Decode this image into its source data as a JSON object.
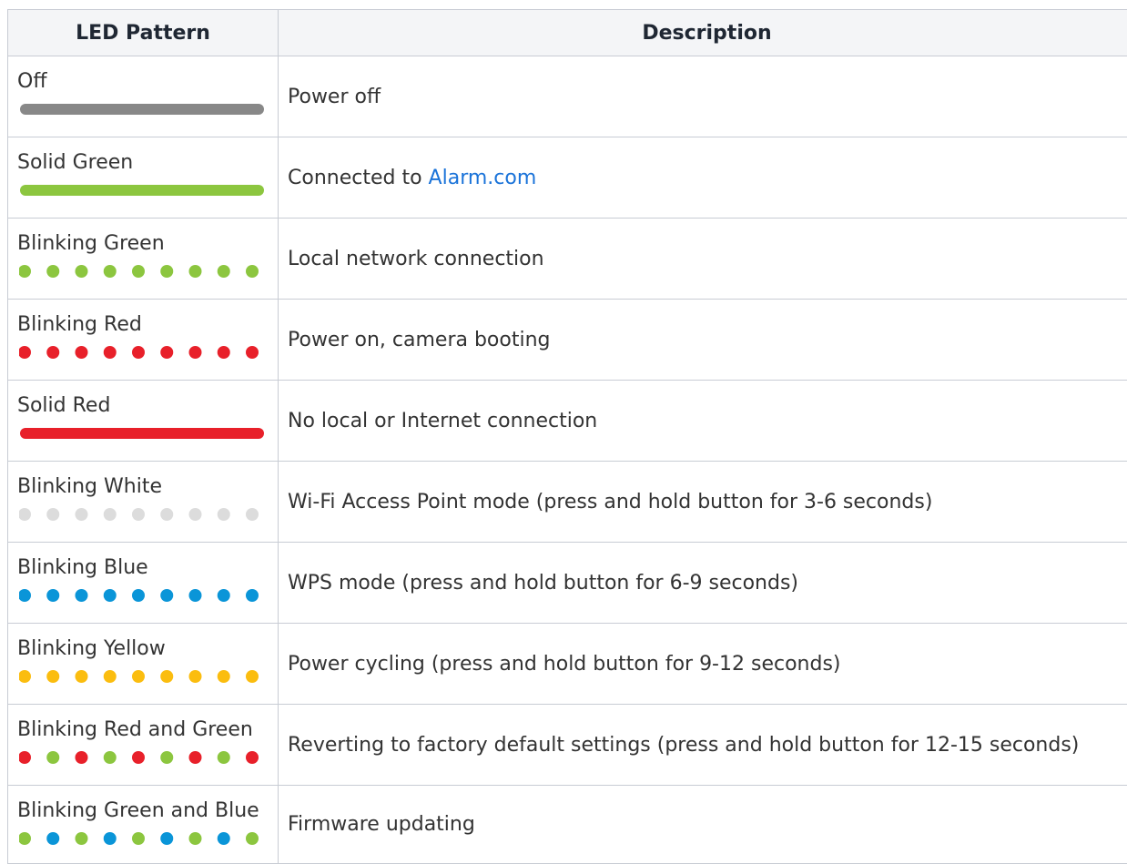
{
  "table": {
    "headers": {
      "pattern": "LED Pattern",
      "description": "Description"
    },
    "rows": [
      {
        "name": "Off",
        "style": "solid",
        "colors": [
          "#888888"
        ],
        "description": "Power off",
        "link": ""
      },
      {
        "name": "Solid Green",
        "style": "solid",
        "colors": [
          "#8cc63f"
        ],
        "description": "Connected to ",
        "link": "Alarm.com"
      },
      {
        "name": "Blinking Green",
        "style": "dots",
        "colors": [
          "#8cc63f"
        ],
        "description": "Local network connection",
        "link": ""
      },
      {
        "name": "Blinking Red",
        "style": "dots",
        "colors": [
          "#e8202a"
        ],
        "description": "Power on, camera booting",
        "link": ""
      },
      {
        "name": "Solid Red",
        "style": "solid",
        "colors": [
          "#e8202a"
        ],
        "description": "No local or Internet connection",
        "link": ""
      },
      {
        "name": "Blinking White",
        "style": "dots",
        "colors": [
          "#dcdcdc"
        ],
        "description": "Wi-Fi Access Point mode (press and hold button for 3-6 seconds)",
        "link": ""
      },
      {
        "name": "Blinking Blue",
        "style": "dots",
        "colors": [
          "#0a95d8"
        ],
        "description": "WPS mode (press and hold button for 6-9 seconds)",
        "link": ""
      },
      {
        "name": "Blinking Yellow",
        "style": "dots",
        "colors": [
          "#fbbd0f"
        ],
        "description": "Power cycling (press and hold button for 9-12 seconds)",
        "link": ""
      },
      {
        "name": "Blinking Red and Green",
        "style": "dots",
        "colors": [
          "#e8202a",
          "#8cc63f"
        ],
        "description": "Reverting to factory default settings (press and hold button for 12-15 seconds)",
        "link": ""
      },
      {
        "name": "Blinking Green and Blue",
        "style": "dots",
        "colors": [
          "#8cc63f",
          "#0a95d8"
        ],
        "description": "Firmware updating",
        "link": ""
      }
    ]
  }
}
